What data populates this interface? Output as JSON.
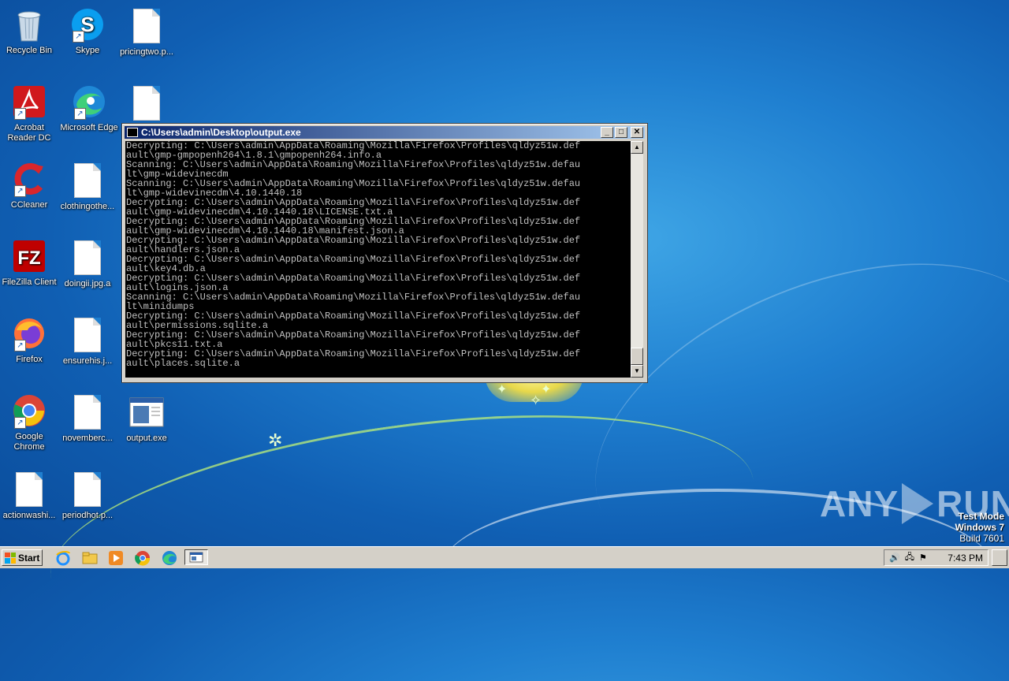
{
  "desktop": {
    "icons": [
      {
        "label": "Recycle Bin"
      },
      {
        "label": "Skype"
      },
      {
        "label": "pricingtwo.p..."
      },
      {
        "label": "Acrobat Reader DC"
      },
      {
        "label": "Microsoft Edge"
      },
      {
        "label": ""
      },
      {
        "label": "CCleaner"
      },
      {
        "label": "clothingothe..."
      },
      {
        "label": "FileZilla Client"
      },
      {
        "label": "doingii.jpg.a"
      },
      {
        "label": "Firefox"
      },
      {
        "label": "ensurehis.j..."
      },
      {
        "label": "Google Chrome"
      },
      {
        "label": "novemberc..."
      },
      {
        "label": "output.exe"
      },
      {
        "label": "actionwashi..."
      },
      {
        "label": "periodhot.p..."
      }
    ]
  },
  "window": {
    "title": "C:\\Users\\admin\\Desktop\\output.exe",
    "console_text": "Decrypting: C:\\Users\\admin\\AppData\\Roaming\\Mozilla\\Firefox\\Profiles\\qldyz51w.def\nault\\gmp-gmpopenh264\\1.8.1\\gmpopenh264.info.a\nScanning: C:\\Users\\admin\\AppData\\Roaming\\Mozilla\\Firefox\\Profiles\\qldyz51w.defau\nlt\\gmp-widevinecdm\nScanning: C:\\Users\\admin\\AppData\\Roaming\\Mozilla\\Firefox\\Profiles\\qldyz51w.defau\nlt\\gmp-widevinecdm\\4.10.1440.18\nDecrypting: C:\\Users\\admin\\AppData\\Roaming\\Mozilla\\Firefox\\Profiles\\qldyz51w.def\nault\\gmp-widevinecdm\\4.10.1440.18\\LICENSE.txt.a\nDecrypting: C:\\Users\\admin\\AppData\\Roaming\\Mozilla\\Firefox\\Profiles\\qldyz51w.def\nault\\gmp-widevinecdm\\4.10.1440.18\\manifest.json.a\nDecrypting: C:\\Users\\admin\\AppData\\Roaming\\Mozilla\\Firefox\\Profiles\\qldyz51w.def\nault\\handlers.json.a\nDecrypting: C:\\Users\\admin\\AppData\\Roaming\\Mozilla\\Firefox\\Profiles\\qldyz51w.def\nault\\key4.db.a\nDecrypting: C:\\Users\\admin\\AppData\\Roaming\\Mozilla\\Firefox\\Profiles\\qldyz51w.def\nault\\logins.json.a\nScanning: C:\\Users\\admin\\AppData\\Roaming\\Mozilla\\Firefox\\Profiles\\qldyz51w.defau\nlt\\minidumps\nDecrypting: C:\\Users\\admin\\AppData\\Roaming\\Mozilla\\Firefox\\Profiles\\qldyz51w.def\nault\\permissions.sqlite.a\nDecrypting: C:\\Users\\admin\\AppData\\Roaming\\Mozilla\\Firefox\\Profiles\\qldyz51w.def\nault\\pkcs11.txt.a\nDecrypting: C:\\Users\\admin\\AppData\\Roaming\\Mozilla\\Firefox\\Profiles\\qldyz51w.def\nault\\places.sqlite.a"
  },
  "watermark": {
    "brand_left": "ANY",
    "brand_right": "RUN",
    "test_mode": "Test Mode",
    "os": "Windows 7",
    "build": "Build 7601"
  },
  "taskbar": {
    "start_label": "Start",
    "clock": "7:43 PM",
    "quicklaunch": [
      "internet-explorer-icon",
      "folder-icon",
      "media-player-icon",
      "chrome-icon",
      "edge-icon",
      "console-task-icon"
    ]
  },
  "colors": {
    "title_bar_start": "#0a246a",
    "title_bar_end": "#a6caf0",
    "console_bg": "#000000",
    "console_text": "#c0c0c0"
  }
}
